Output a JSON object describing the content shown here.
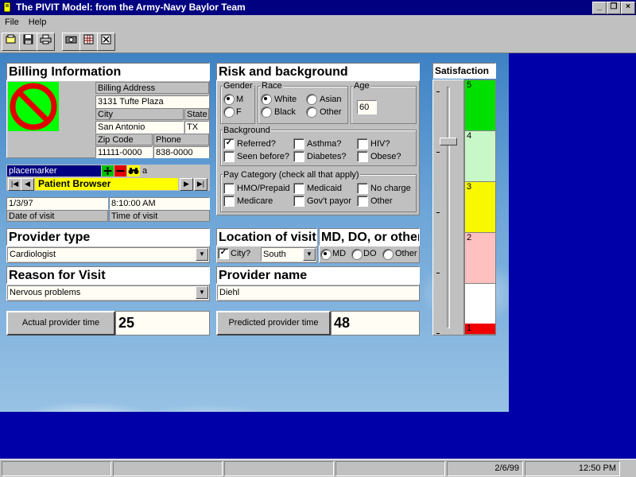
{
  "window": {
    "title": "The PIVIT Model:  from the Army-Navy Baylor Team",
    "controls": [
      "_",
      "❐",
      "×"
    ]
  },
  "menu": {
    "file": "File",
    "help": "Help"
  },
  "toolbar": {
    "icons": [
      "new-icon",
      "save-icon",
      "print-icon",
      "camera-icon",
      "grid-icon",
      "close-x-icon"
    ]
  },
  "billing": {
    "title": "Billing Information",
    "address_label": "Billing Address",
    "address": "3131 Tufte Plaza",
    "city_label": "City",
    "city": "San Antonio",
    "state_label": "State",
    "state": "TX",
    "zip_label": "Zip Code",
    "zip": "11111-0000",
    "phone_label": "Phone",
    "phone": "838-0000"
  },
  "browser": {
    "placemarker": "placemarker",
    "trailing": "a",
    "label": "Patient Browser",
    "date": "1/3/97",
    "date_label": "Date of visit",
    "time": "8:10:00 AM",
    "time_label": "Time of visit"
  },
  "risk": {
    "title": "Risk and background",
    "gender_label": "Gender",
    "gender_m": "M",
    "gender_f": "F",
    "race_label": "Race",
    "race_white": "White",
    "race_black": "Black",
    "race_asian": "Asian",
    "race_other": "Other",
    "age_label": "Age",
    "age": "60",
    "background_label": "Background",
    "referred": "Referred?",
    "asthma": "Asthma?",
    "hiv": "HIV?",
    "seen_before": "Seen before?",
    "diabetes": "Diabetes?",
    "obese": "Obese?",
    "pay_label": "Pay Category (check all that apply)",
    "hmo": "HMO/Prepaid",
    "medicaid": "Medicaid",
    "no_charge": "No charge",
    "medicare": "Medicare",
    "govt": "Gov't payor",
    "pay_other": "Other"
  },
  "provider_type": {
    "title": "Provider type",
    "value": "Cardiologist"
  },
  "location": {
    "title": "Location of visit",
    "city_label": "City?",
    "city_value": "South"
  },
  "md": {
    "title": "MD, DO, or other",
    "md": "MD",
    "do": "DO",
    "other": "Other"
  },
  "reason": {
    "title": "Reason for Visit",
    "value": "Nervous problems"
  },
  "provider_name": {
    "title": "Provider name",
    "value": "Diehl"
  },
  "times": {
    "actual_label": "Actual provider time",
    "actual": "25",
    "predicted_label": "Predicted provider time",
    "predicted": "48"
  },
  "satisfaction": {
    "title": "Satisfaction",
    "level": 4,
    "bands": [
      {
        "label": "5",
        "color": "#00e000"
      },
      {
        "label": "4",
        "color": "#c8f8c8"
      },
      {
        "label": "3",
        "color": "#f8f800"
      },
      {
        "label": "2",
        "color": "#ffc0c0"
      },
      {
        "label": "1",
        "color": "#f00000"
      }
    ]
  },
  "status": {
    "date": "2/6/99",
    "time": "12:50 PM"
  }
}
